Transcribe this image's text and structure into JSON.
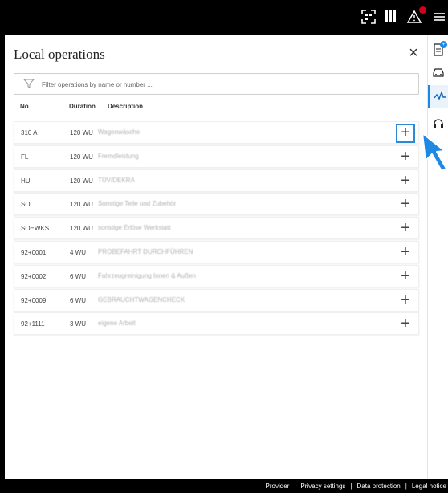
{
  "header": {
    "icons": [
      "qr-scan-icon",
      "apps-grid-icon",
      "alert-icon",
      "menu-icon"
    ]
  },
  "panel": {
    "title": "Local operations",
    "close_label": "×",
    "search_placeholder": "Filter operations by name or number ...",
    "columns": {
      "no": "No",
      "duration": "Duration",
      "description": "Description"
    },
    "rows": [
      {
        "no": "310 A",
        "duration": "120 WU",
        "description": "Wagenwäsche"
      },
      {
        "no": "FL",
        "duration": "120 WU",
        "description": "Fremdleistung"
      },
      {
        "no": "HU",
        "duration": "120 WU",
        "description": "TÜV/DEKRA"
      },
      {
        "no": "SO",
        "duration": "120 WU",
        "description": "Sonstige Teile und Zubehör"
      },
      {
        "no": "SOEWKS",
        "duration": "120 WU",
        "description": "sonstige Erlöse Werkstatt"
      },
      {
        "no": "92+0001",
        "duration": "4 WU",
        "description": "PROBEFAHRT DURCHFÜHREN"
      },
      {
        "no": "92+0002",
        "duration": "6 WU",
        "description": "Fahrzeugreinigung Innen & Außen"
      },
      {
        "no": "92+0009",
        "duration": "6 WU",
        "description": "GEBRAUCHTWAGENCHECK"
      },
      {
        "no": "92+1111",
        "duration": "3 WU",
        "description": "eigene Arbeit"
      }
    ],
    "add_label": "+"
  },
  "rail": {
    "items": [
      "document-icon",
      "car-icon",
      "operations-icon",
      "headset-icon"
    ],
    "badge": "+"
  },
  "footer": {
    "links": [
      "Provider",
      "Privacy settings",
      "Data protection",
      "Legal notice"
    ],
    "separator": "|"
  },
  "colors": {
    "accent": "#1e88e5",
    "alert": "#d5001c",
    "topbar": "#000000"
  }
}
